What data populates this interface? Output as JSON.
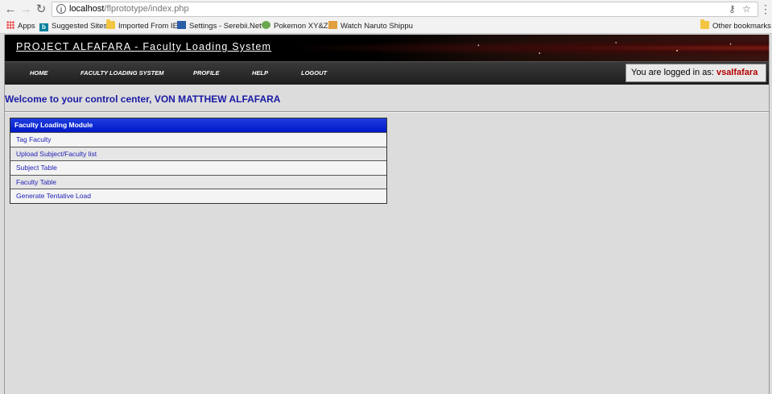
{
  "browser": {
    "url_host": "localhost",
    "url_path": "/flprototype/index.php",
    "bookmarks": [
      {
        "label": "Apps",
        "icon": "apps-grid-icon"
      },
      {
        "label": "Suggested Sites",
        "icon": "bing-icon"
      },
      {
        "label": "Imported From IE",
        "icon": "folder-icon"
      },
      {
        "label": "Settings - Serebii.Net",
        "icon": "site-favicon-icon"
      },
      {
        "label": "Pokemon XY&Z",
        "icon": "site-favicon-icon"
      },
      {
        "label": "Watch Naruto Shippu",
        "icon": "site-favicon-icon"
      }
    ],
    "other_bookmarks": "Other bookmarks"
  },
  "header": {
    "title": "PROJECT ALFAFARA - Faculty Loading System"
  },
  "nav": {
    "items": [
      "HOME",
      "FACULTY LOADING SYSTEM",
      "PROFILE",
      "HELP",
      "LOGOUT"
    ]
  },
  "login": {
    "prefix": "You are logged in as:",
    "username": "vsalfafara"
  },
  "welcome": "Welcome to your control center, VON MATTHEW ALFAFARA",
  "module": {
    "title": "Faculty Loading Module",
    "items": [
      "Tag Faculty",
      "Upload Subject/Faculty list",
      "Subject Table",
      "Faculty Table",
      "Generate Tentative Load"
    ]
  },
  "colors": {
    "module_header": "#0019c8",
    "link": "#2222b8",
    "welcome": "#1a1aa6",
    "username": "#b40000"
  }
}
